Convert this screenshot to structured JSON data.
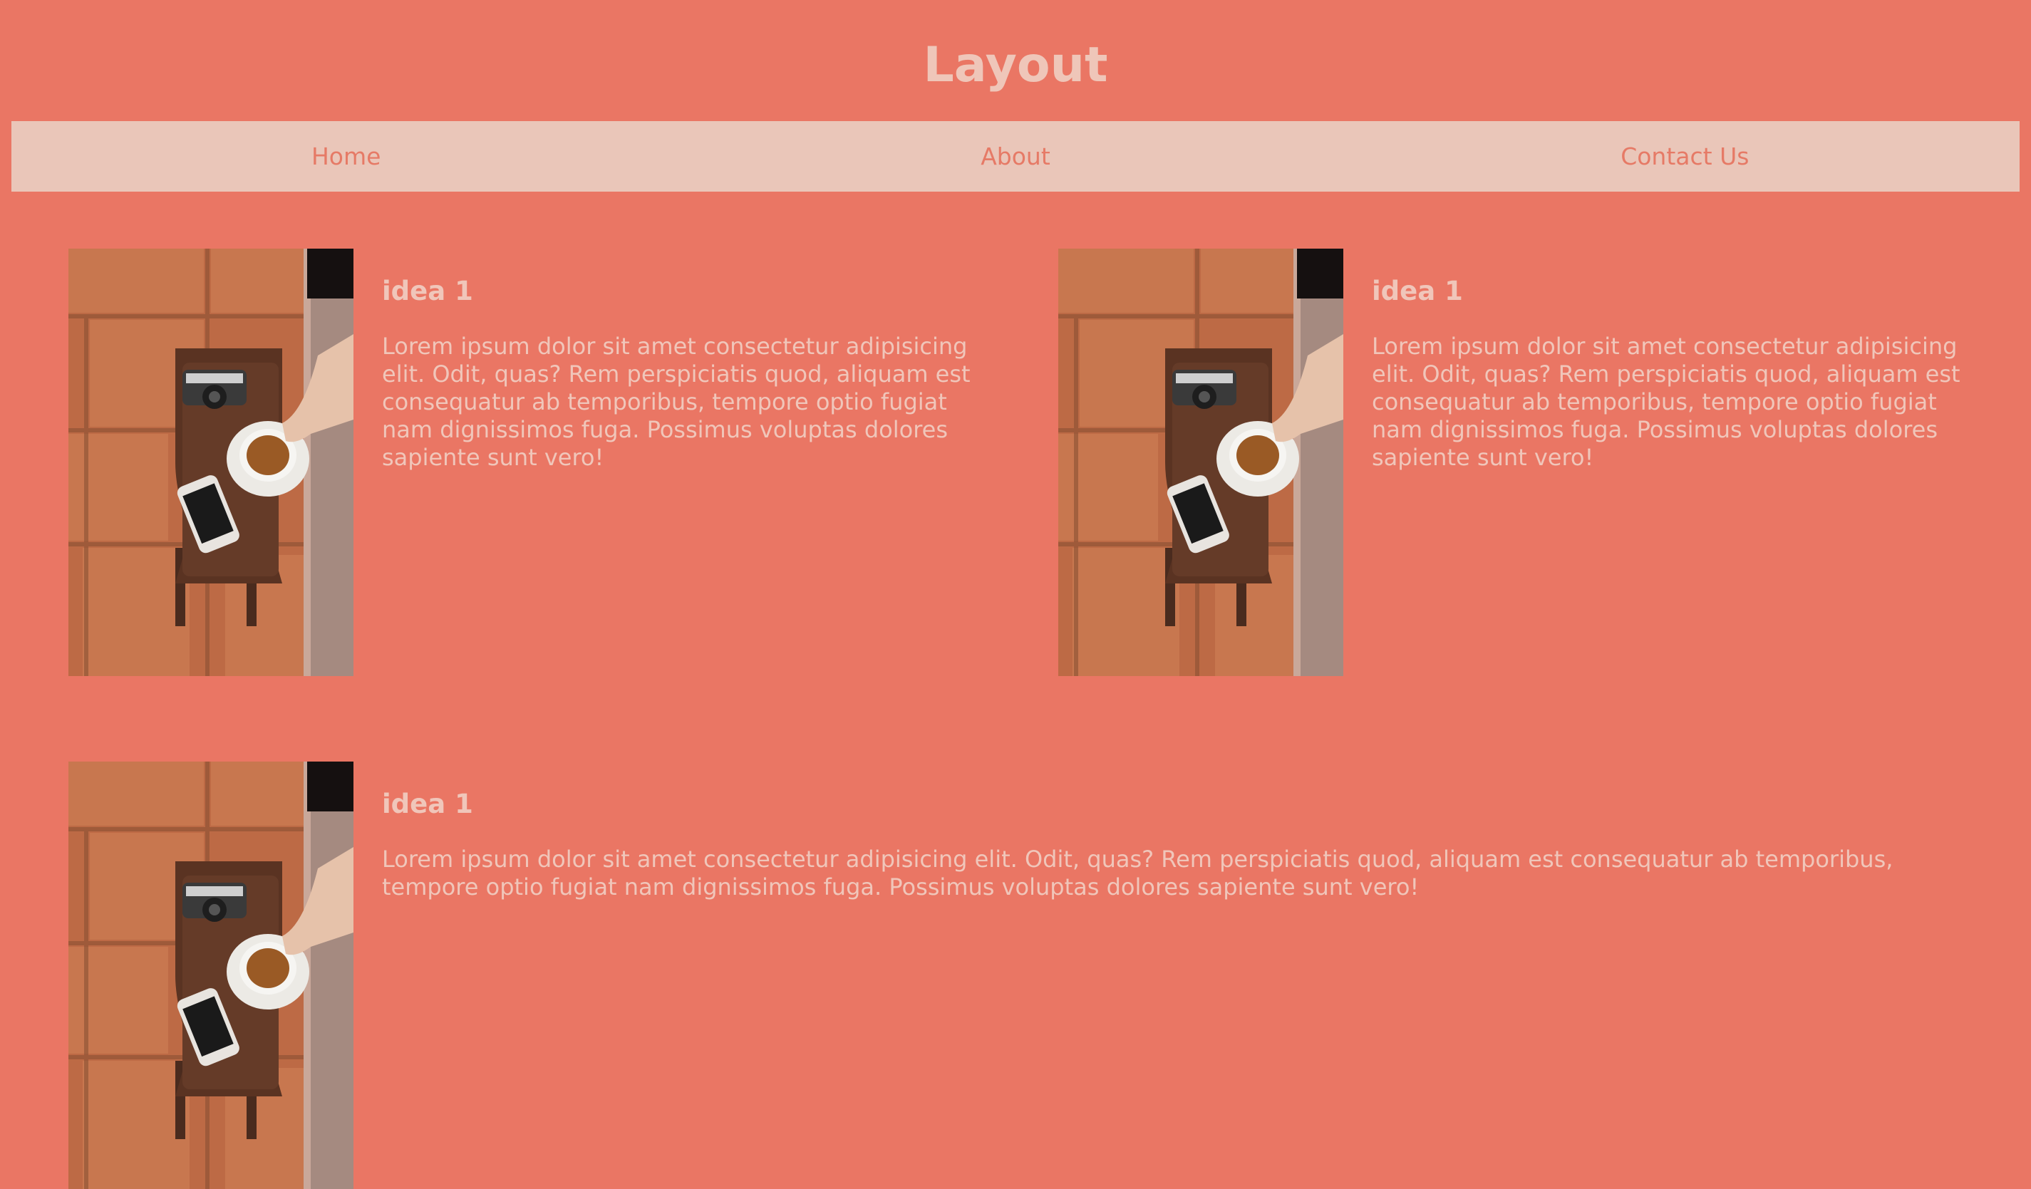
{
  "page": {
    "title": "Layout"
  },
  "nav": {
    "items": [
      {
        "label": "Home"
      },
      {
        "label": "About"
      },
      {
        "label": "Contact Us"
      }
    ]
  },
  "cards": [
    {
      "title": "idea 1",
      "text": "Lorem ipsum dolor sit amet consectetur adipisicing elit. Odit, quas? Rem perspiciatis quod, aliquam est consequatur ab temporibus, tempore optio fugiat nam dignissimos fuga. Possimus voluptas dolores sapiente sunt vero!"
    },
    {
      "title": "idea 1",
      "text": "Lorem ipsum dolor sit amet consectetur adipisicing elit. Odit, quas? Rem perspiciatis quod, aliquam est consequatur ab temporibus, tempore optio fugiat nam dignissimos fuga. Possimus voluptas dolores sapiente sunt vero!"
    },
    {
      "title": "idea 1",
      "text": "Lorem ipsum dolor sit amet consectetur adipisicing elit. Odit, quas? Rem perspiciatis quod, aliquam est consequatur ab temporibus, tempore optio fugiat nam dignissimos fuga. Possimus voluptas dolores sapiente sunt vero!"
    }
  ],
  "colors": {
    "background": "#ea7664",
    "nav_background": "#eac6b9",
    "nav_text": "#e67a66",
    "text": "#f0c6ba"
  }
}
